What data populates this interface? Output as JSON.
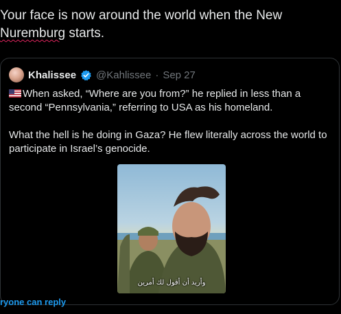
{
  "compose": {
    "line1": "Your face is now around the world when the New",
    "line2_misspelled": "Nuremburg",
    "line2_rest": " starts."
  },
  "quote": {
    "author_name": "Khalissee",
    "handle": "@Kahlissee",
    "separator": "·",
    "date": "Sep 27",
    "paragraph1": "When asked, “Where are you from?” he replied in less than a second “Pennsylvania,” referring to USA as his homeland.",
    "paragraph2": "What the hell is he doing in Gaza? He flew literally across the world to participate in Israel’s genocide.",
    "video_caption": "وأريد أن أقول لك أمرين"
  },
  "reply_info": "ryone can reply",
  "colors": {
    "link_blue": "#1d9bf0",
    "verified_blue": "#1d9bf0",
    "muted": "#71767b"
  }
}
